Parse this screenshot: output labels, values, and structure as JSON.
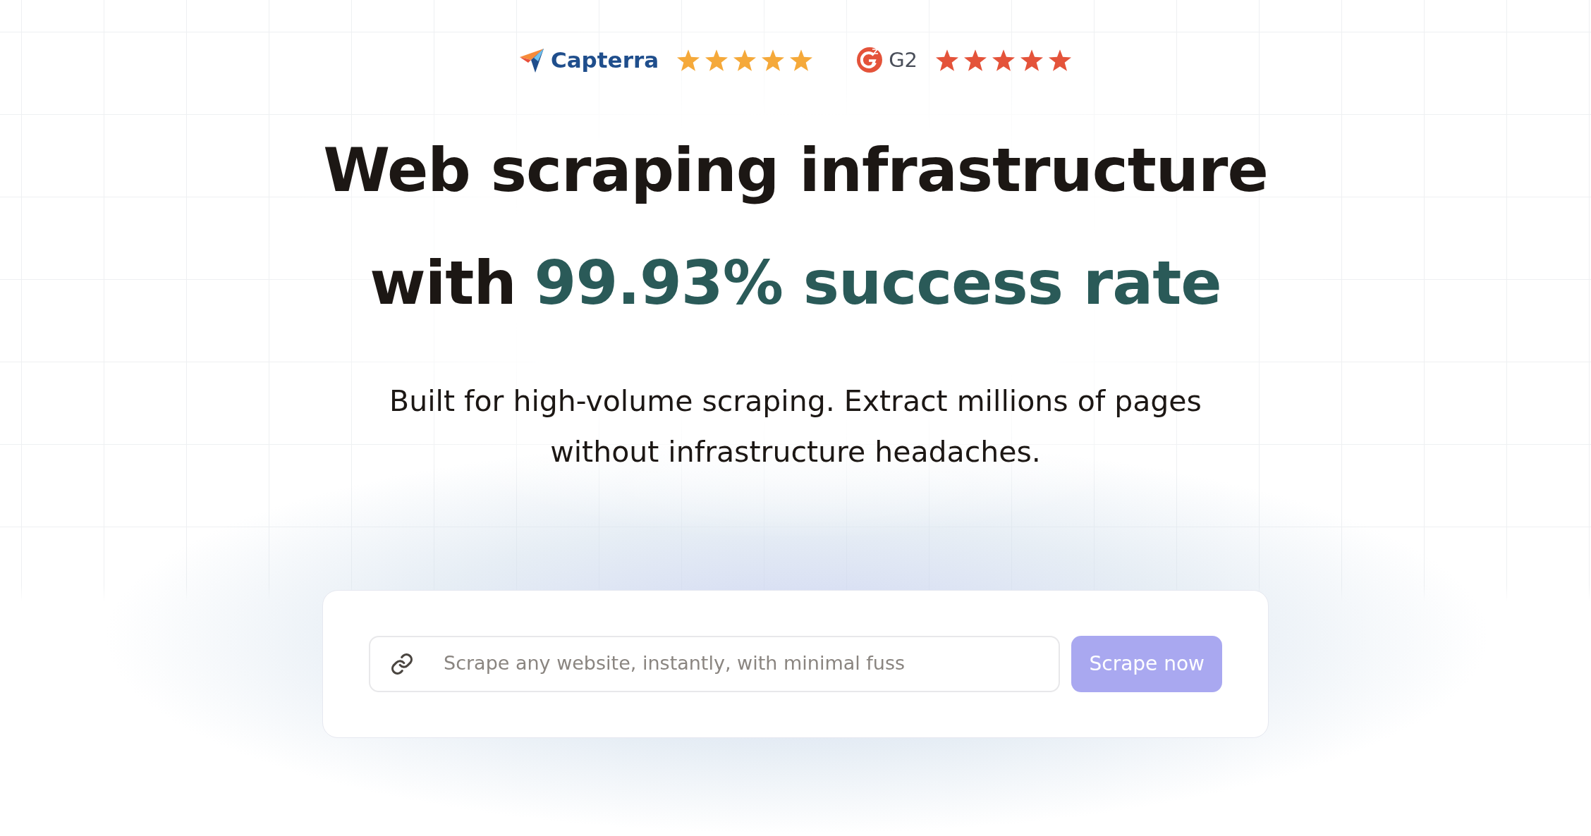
{
  "ratings": [
    {
      "kind": "capterra",
      "name": "Capterra",
      "stars": 5,
      "color": "#f5a93a"
    },
    {
      "kind": "g2",
      "name": "G2",
      "stars": 5,
      "color": "#e4533a"
    }
  ],
  "headline": {
    "line_1": "Web scraping infrastructure",
    "line_2_start": "with",
    "line_2_highlight": "99.93% success rate"
  },
  "subtitle": "Built for high-volume scraping. Extract millions of pages without infrastructure headaches.",
  "scrape_form": {
    "placeholder": "Scrape any website, instantly, with minimal fuss",
    "button": {
      "label": "Scrape now",
      "disabled": true
    }
  }
}
